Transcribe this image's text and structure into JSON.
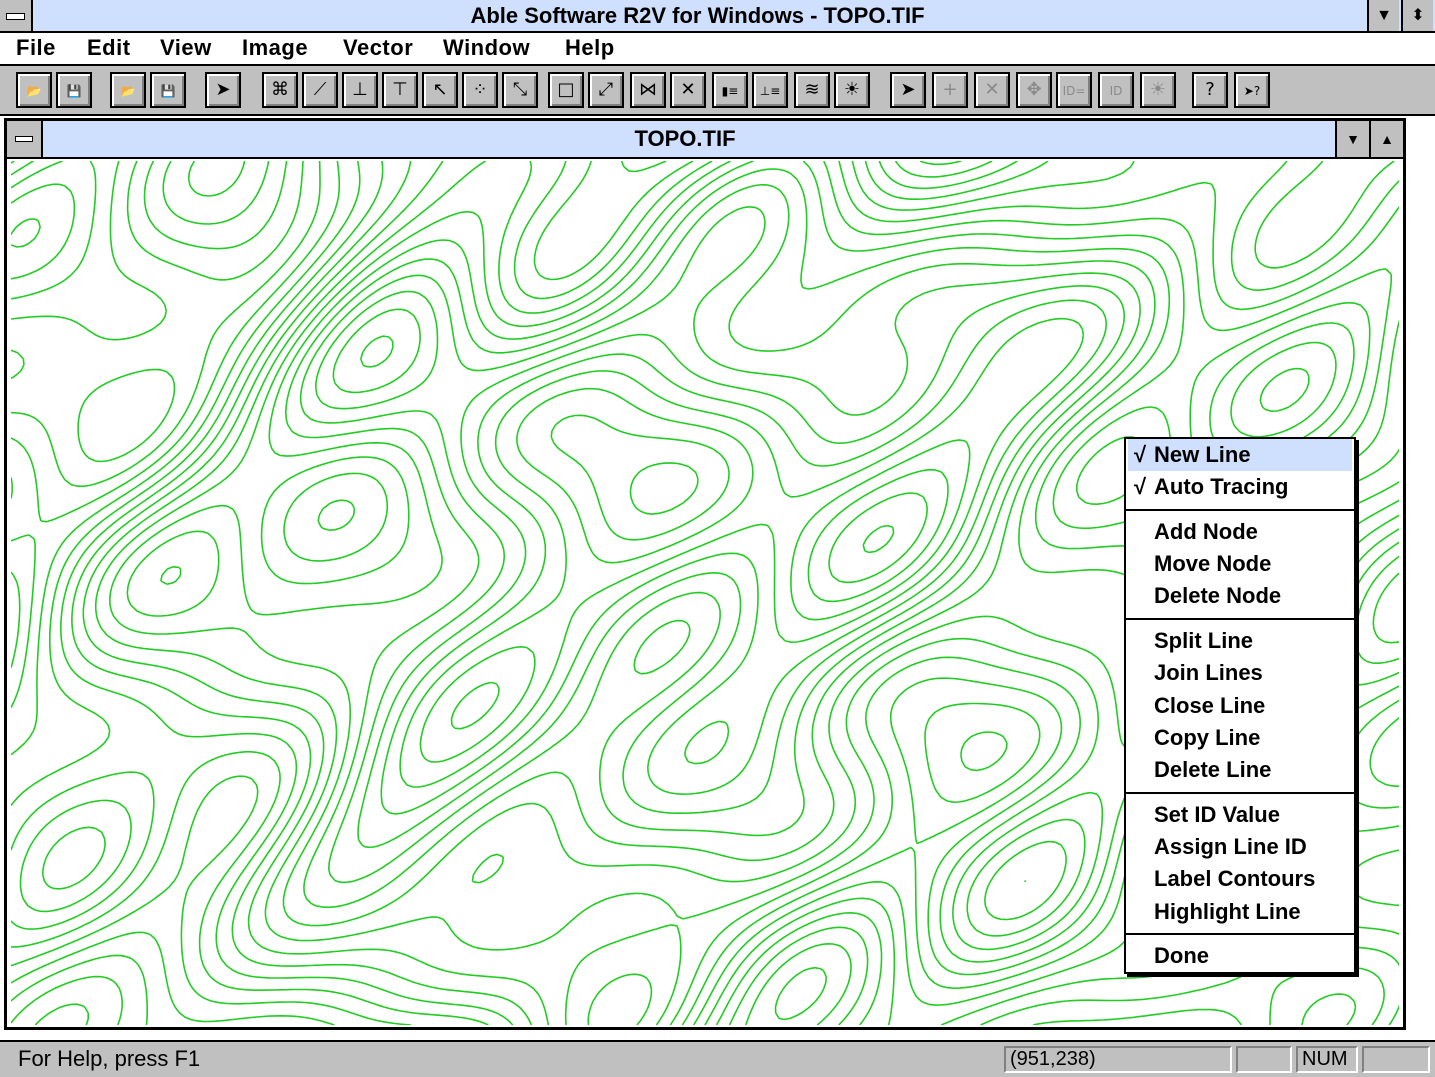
{
  "app": {
    "title": "Able Software R2V for Windows - TOPO.TIF"
  },
  "menubar": {
    "items": [
      "File",
      "Edit",
      "View",
      "Image",
      "Vector",
      "Window",
      "Help"
    ]
  },
  "toolbar": {
    "buttons": [
      {
        "name": "open-icon",
        "glyph": "📂",
        "enabled": true
      },
      {
        "name": "save-icon",
        "glyph": "💾",
        "enabled": true
      },
      {
        "name": "open-vector-icon",
        "glyph": "📂",
        "enabled": true
      },
      {
        "name": "save-vector-icon",
        "glyph": "💾",
        "enabled": false
      },
      {
        "name": "pointer-icon",
        "glyph": "➤",
        "enabled": true
      },
      {
        "name": "auto-trace-icon",
        "glyph": "⌘",
        "enabled": true
      },
      {
        "name": "draw-line-icon",
        "glyph": "⟋",
        "enabled": true
      },
      {
        "name": "add-node-icon",
        "glyph": "⊥",
        "enabled": true
      },
      {
        "name": "delete-node-icon",
        "glyph": "⊤",
        "enabled": true
      },
      {
        "name": "move-node-icon",
        "glyph": "↖",
        "enabled": true
      },
      {
        "name": "select-nodes-icon",
        "glyph": "⁘",
        "enabled": true
      },
      {
        "name": "split-line-icon",
        "glyph": "⤡",
        "enabled": true
      },
      {
        "name": "close-line-icon",
        "glyph": "□",
        "enabled": true
      },
      {
        "name": "join-lines-icon",
        "glyph": "⤢",
        "enabled": true
      },
      {
        "name": "cut-line-icon",
        "glyph": "⋈",
        "enabled": true
      },
      {
        "name": "delete-line-icon",
        "glyph": "✕",
        "enabled": true
      },
      {
        "name": "set-id-icon",
        "glyph": "▮≡",
        "enabled": true
      },
      {
        "name": "assign-id-icon",
        "glyph": "⊥≡",
        "enabled": true
      },
      {
        "name": "label-contours-icon",
        "glyph": "≋",
        "enabled": true
      },
      {
        "name": "highlight-line-icon",
        "glyph": "☀",
        "enabled": true
      },
      {
        "name": "select-point-icon",
        "glyph": "➤",
        "enabled": true
      },
      {
        "name": "add-point-icon",
        "glyph": "+",
        "enabled": false
      },
      {
        "name": "delete-point-icon",
        "glyph": "✕",
        "enabled": false
      },
      {
        "name": "move-point-icon",
        "glyph": "✥",
        "enabled": false
      },
      {
        "name": "point-id-icon",
        "glyph": "ID=",
        "enabled": false
      },
      {
        "name": "point-label-icon",
        "glyph": "ID",
        "enabled": false
      },
      {
        "name": "point-highlight-icon",
        "glyph": "☀",
        "enabled": false
      },
      {
        "name": "help-icon",
        "glyph": "?",
        "enabled": true
      },
      {
        "name": "context-help-icon",
        "glyph": "➤?",
        "enabled": true
      }
    ]
  },
  "document": {
    "title": "TOPO.TIF"
  },
  "context_menu": {
    "items": [
      {
        "label": "New Line",
        "checked": true,
        "highlighted": true
      },
      {
        "label": "Auto Tracing",
        "checked": true
      },
      {
        "label": "Add Node"
      },
      {
        "label": "Move Node"
      },
      {
        "label": "Delete Node"
      },
      {
        "label": "Split Line"
      },
      {
        "label": "Join Lines"
      },
      {
        "label": "Close Line"
      },
      {
        "label": "Copy Line"
      },
      {
        "label": "Delete Line"
      },
      {
        "label": "Set ID Value"
      },
      {
        "label": "Assign Line ID"
      },
      {
        "label": "Label Contours"
      },
      {
        "label": "Highlight Line"
      },
      {
        "label": "Done"
      }
    ],
    "check_glyph": "√"
  },
  "statusbar": {
    "help_text": "For Help, press F1",
    "coordinates": "(951,238)",
    "num_indicator": "NUM"
  },
  "colors": {
    "titlebar": "#cfe0ff",
    "contour": "#22cc22",
    "chrome": "#c0c0c0"
  }
}
